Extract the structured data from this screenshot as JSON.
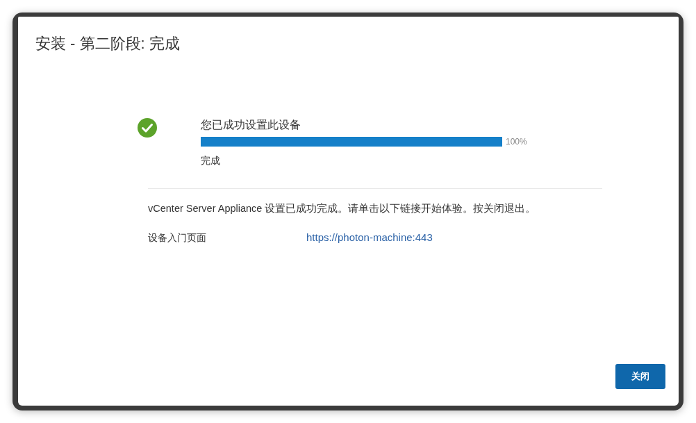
{
  "dialog": {
    "title": "安装 - 第二阶段: 完成"
  },
  "status": {
    "kind": "success",
    "heading": "您已成功设置此设备",
    "progress": {
      "level": 1,
      "reading": "100%"
    },
    "state_text": "完成"
  },
  "message": "vCenter Server Appliance 设置已成功完成。请单击以下链接开始体验。按关闭退出。",
  "links": [
    {
      "label": "设备入门页面",
      "url": "https://photon-machine:443"
    }
  ],
  "buttons": [
    {
      "label": "关闭",
      "kind": "primary"
    }
  ]
}
